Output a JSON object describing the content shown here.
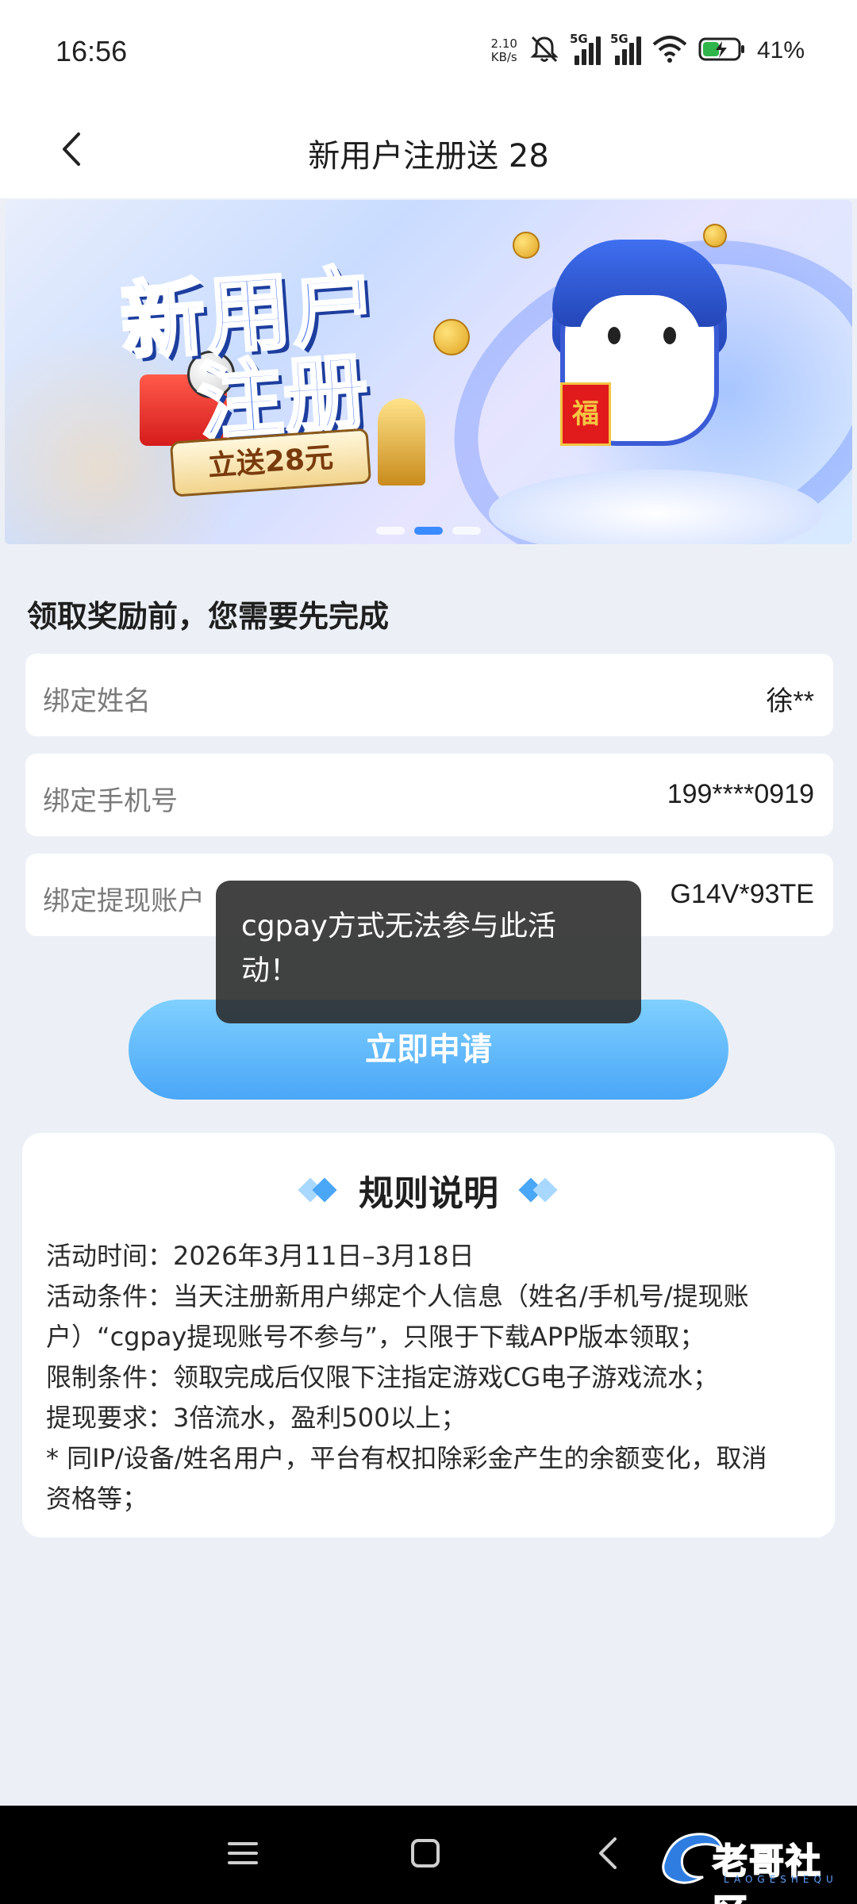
{
  "status_bar": {
    "time": "16:56",
    "net_speed_value": "2.10",
    "net_speed_unit": "KB/s",
    "sim1": "5G",
    "sim2": "5G",
    "battery": "41%",
    "icons": [
      "mute-bell-icon",
      "signal-icon",
      "signal-icon",
      "wifi-icon",
      "battery-charging-icon"
    ]
  },
  "header": {
    "title": "新用户注册送 28",
    "back_icon": "chevron-left-icon"
  },
  "banner": {
    "headline_line1": "新用户",
    "headline_line2": "注册",
    "ribbon": "立送28元",
    "mascot_badge": "福",
    "slides": 3,
    "active_slide": 2
  },
  "form": {
    "section_title": "领取奖励前，您需要先完成",
    "fields": [
      {
        "label": "绑定姓名",
        "value": "徐**"
      },
      {
        "label": "绑定手机号",
        "value": "199****0919"
      },
      {
        "label": "绑定提现账户",
        "value": "G14V*93TE"
      }
    ],
    "apply_label": "立即申请"
  },
  "toast": {
    "line1": "cgpay方式无法参与此活",
    "line2": "动！"
  },
  "rules": {
    "title": "规则说明",
    "lines": [
      "活动时间：2026年3月11日–3月18日",
      "活动条件：当天注册新用户绑定个人信息（姓名/手机号/提现账",
      "户）“cgpay提现账号不参与”，只限于下载APP版本领取；",
      "限制条件：领取完成后仅限下注指定游戏CG电子游戏流水；",
      "提现要求：3倍流水，盈利500以上；",
      "* 同IP/设备/姓名用户，平台有权扣除彩金产生的余额变化，取消",
      "资格等；"
    ]
  },
  "nav_bar": {
    "icons": [
      "menu-icon",
      "home-square-icon",
      "back-icon"
    ],
    "watermark_text": "老哥社区",
    "watermark_sub": "LAOGESHEQU"
  },
  "colors": {
    "accent_blue": "#4aa6f7",
    "page_bg": "#ecf0f6",
    "toast_bg": "#282828"
  }
}
